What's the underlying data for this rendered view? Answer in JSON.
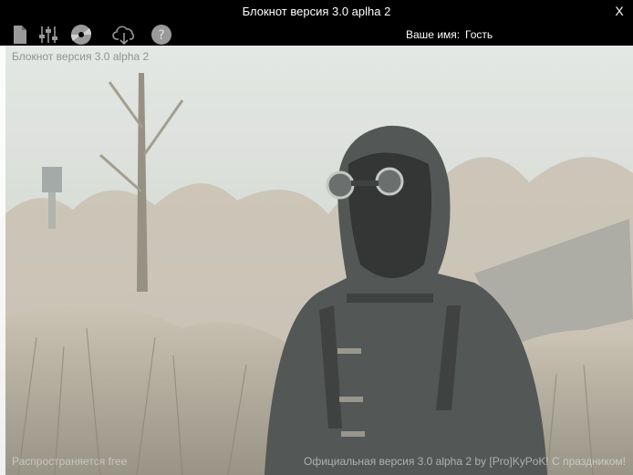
{
  "window": {
    "title": "Блокнот версия 3.0 aplha 2",
    "close_label": "X"
  },
  "toolbar": {
    "icons": [
      "new-document-icon",
      "settings-sliders-icon",
      "disc-icon",
      "cloud-download-icon",
      "help-icon"
    ],
    "user_label": "Ваше имя:",
    "user_name": "Гость"
  },
  "editor": {
    "heading": "Блокнот версия 3.0 alpha 2"
  },
  "status": {
    "left_text": "Распространяется free",
    "right_text": "Официальная версия 3.0 alpha 2 by [Pro]KyPoK! С праздником!"
  },
  "colors": {
    "bar_background": "#000000",
    "bar_text": "#ffffff",
    "icon_gray": "#9a9a9a"
  }
}
